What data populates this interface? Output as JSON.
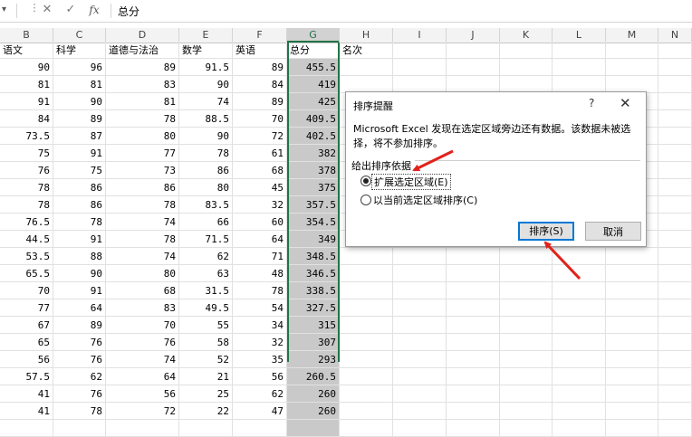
{
  "formula_bar": {
    "name_box_dropdown": "▾",
    "cancel_icon": "✕",
    "enter_icon": "✓",
    "fx_label": "fx",
    "content": "总分"
  },
  "columns": [
    "B",
    "C",
    "D",
    "E",
    "F",
    "G",
    "H",
    "I",
    "J",
    "K",
    "L",
    "M",
    "N"
  ],
  "selected_column": "G",
  "headers": [
    "语文",
    "科学",
    "道德与法治",
    "数学",
    "英语",
    "总分",
    "名次"
  ],
  "rows": [
    [
      "90",
      "96",
      "89",
      "91.5",
      "89",
      "455.5"
    ],
    [
      "81",
      "81",
      "83",
      "90",
      "84",
      "419"
    ],
    [
      "91",
      "90",
      "81",
      "74",
      "89",
      "425"
    ],
    [
      "84",
      "89",
      "78",
      "88.5",
      "70",
      "409.5"
    ],
    [
      "73.5",
      "87",
      "80",
      "90",
      "72",
      "402.5"
    ],
    [
      "75",
      "91",
      "77",
      "78",
      "61",
      "382"
    ],
    [
      "76",
      "75",
      "73",
      "86",
      "68",
      "378"
    ],
    [
      "78",
      "86",
      "86",
      "80",
      "45",
      "375"
    ],
    [
      "78",
      "86",
      "78",
      "83.5",
      "32",
      "357.5"
    ],
    [
      "76.5",
      "78",
      "74",
      "66",
      "60",
      "354.5"
    ],
    [
      "44.5",
      "91",
      "78",
      "71.5",
      "64",
      "349"
    ],
    [
      "53.5",
      "88",
      "74",
      "62",
      "71",
      "348.5"
    ],
    [
      "65.5",
      "90",
      "80",
      "63",
      "48",
      "346.5"
    ],
    [
      "70",
      "91",
      "68",
      "31.5",
      "78",
      "338.5"
    ],
    [
      "77",
      "64",
      "83",
      "49.5",
      "54",
      "327.5"
    ],
    [
      "67",
      "89",
      "70",
      "55",
      "34",
      "315"
    ],
    [
      "65",
      "76",
      "76",
      "58",
      "32",
      "307"
    ],
    [
      "56",
      "76",
      "74",
      "52",
      "35",
      "293"
    ],
    [
      "57.5",
      "62",
      "64",
      "21",
      "56",
      "260.5"
    ],
    [
      "41",
      "76",
      "56",
      "25",
      "62",
      "260"
    ],
    [
      "41",
      "78",
      "72",
      "22",
      "47",
      "260"
    ],
    [
      "",
      "",
      "",
      "",
      "",
      ""
    ]
  ],
  "dialog": {
    "title": "排序提醒",
    "help": "?",
    "close": "✕",
    "message": "Microsoft Excel 发现在选定区域旁边还有数据。该数据未被选择，将不参加排序。",
    "group_label": "给出排序依据",
    "option_expand": "扩展选定区域(E)",
    "option_current": "以当前选定区域排序(C)",
    "selected_option": "expand",
    "sort_button": "排序(S)",
    "cancel_button": "取消"
  },
  "annotation_color": "#e0221a"
}
